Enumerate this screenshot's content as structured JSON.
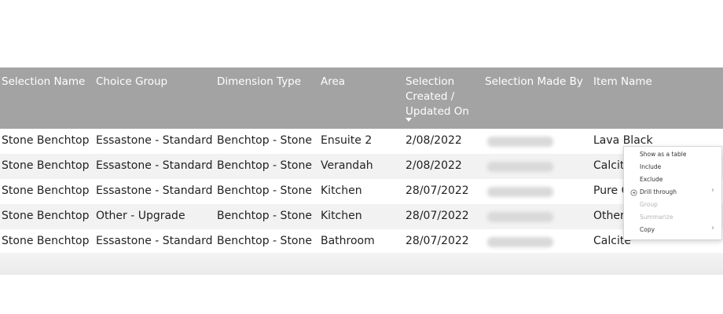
{
  "table": {
    "columns": [
      "Selection Name",
      "Choice Group",
      "Dimension Type",
      "Area",
      "Selection\nCreated /\nUpdated On",
      "Selection Made By",
      "Item Name"
    ],
    "rows": [
      {
        "selection_name": "Stone Benchtop",
        "choice_group": "Essastone - Standard",
        "dimension_type": "Benchtop - Stone",
        "area": "Ensuite 2",
        "updated_on": "2/08/2022",
        "item_name": "Lava Black"
      },
      {
        "selection_name": "Stone Benchtop",
        "choice_group": "Essastone - Standard",
        "dimension_type": "Benchtop - Stone",
        "area": "Verandah",
        "updated_on": "2/08/2022",
        "item_name": "Calcite"
      },
      {
        "selection_name": "Stone Benchtop",
        "choice_group": "Essastone - Standard",
        "dimension_type": "Benchtop - Stone",
        "area": "Kitchen",
        "updated_on": "28/07/2022",
        "item_name": "Pure C"
      },
      {
        "selection_name": "Stone Benchtop",
        "choice_group": "Other - Upgrade",
        "dimension_type": "Benchtop - Stone",
        "area": "Kitchen",
        "updated_on": "28/07/2022",
        "item_name": "Other"
      },
      {
        "selection_name": "Stone Benchtop",
        "choice_group": "Essastone - Standard",
        "dimension_type": "Benchtop - Stone",
        "area": "Bathroom",
        "updated_on": "28/07/2022",
        "item_name": "Calcite"
      }
    ]
  },
  "context_menu": {
    "items": [
      {
        "label": "Show as a table",
        "disabled": false,
        "icon": "",
        "submenu": false
      },
      {
        "label": "Include",
        "disabled": false,
        "icon": "",
        "submenu": false
      },
      {
        "label": "Exclude",
        "disabled": false,
        "icon": "",
        "submenu": false
      },
      {
        "label": "Drill through",
        "disabled": false,
        "icon": "drill-through-icon",
        "submenu": true
      },
      {
        "label": "Group",
        "disabled": true,
        "icon": "",
        "submenu": false
      },
      {
        "label": "Summarize",
        "disabled": true,
        "icon": "",
        "submenu": false
      },
      {
        "label": "Copy",
        "disabled": false,
        "icon": "",
        "submenu": true
      }
    ]
  },
  "colors": {
    "header_bg": "#a3a3a3",
    "header_text": "#ffffff",
    "row_alt_bg": "#f2f2f2",
    "disabled_text": "#b5b5b5"
  }
}
